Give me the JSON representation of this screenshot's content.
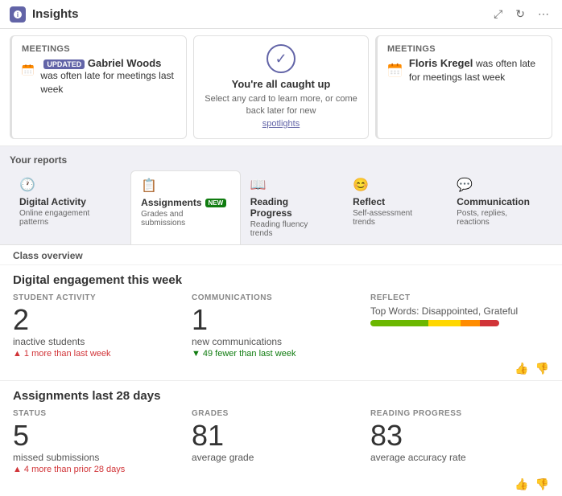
{
  "header": {
    "title": "Insights",
    "actions": [
      "expand",
      "refresh",
      "more"
    ]
  },
  "spotlight": {
    "cards": [
      {
        "id": "card1",
        "type": "meeting",
        "header": "Meetings",
        "badge": "UPDATED",
        "person": "Gabriel Woods",
        "text": "was often late for meetings last week"
      },
      {
        "id": "card-center",
        "type": "caught-up",
        "title": "You're all caught up",
        "sub1": "Select any card to learn more, or come back later for new",
        "link": "spotlights"
      },
      {
        "id": "card3",
        "type": "meeting",
        "header": "Meetings",
        "person": "Floris Kregel",
        "text": "was often late for meetings last week"
      }
    ]
  },
  "reports": {
    "label": "Your reports",
    "tabs": [
      {
        "id": "digital",
        "icon": "🕐",
        "label": "Digital Activity",
        "sub": "Online engagement patterns",
        "active": false
      },
      {
        "id": "assignments",
        "icon": "📋",
        "label": "Assignments",
        "sub": "Grades and submissions",
        "badge": "NEW",
        "active": true
      },
      {
        "id": "reading",
        "icon": "📖",
        "label": "Reading Progress",
        "sub": "Reading fluency trends",
        "active": false
      },
      {
        "id": "reflect",
        "icon": "😊",
        "label": "Reflect",
        "sub": "Self-assessment trends",
        "active": false
      },
      {
        "id": "communication",
        "icon": "💬",
        "label": "Communication",
        "sub": "Posts, replies, reactions",
        "active": false
      }
    ]
  },
  "overview": {
    "label": "Class overview",
    "digital": {
      "title": "Digital engagement",
      "period": "this week",
      "metrics": [
        {
          "label": "STUDENT ACTIVITY",
          "value": "2",
          "desc": "inactive students",
          "change": "1 more than last week",
          "direction": "up"
        },
        {
          "label": "COMMUNICATIONS",
          "value": "1",
          "desc": "new communications",
          "change": "49 fewer than last week",
          "direction": "down"
        },
        {
          "label": "REFLECT",
          "value": null,
          "desc": "Top Words: Disappointed, Grateful",
          "sentiment": [
            45,
            25,
            15,
            15
          ]
        }
      ]
    },
    "assignments": {
      "title": "Assignments",
      "period": "last 28 days",
      "metrics": [
        {
          "label": "STATUS",
          "value": "5",
          "desc": "missed submissions",
          "change": "4 more than prior 28 days",
          "direction": "up"
        },
        {
          "label": "GRADES",
          "value": "81",
          "desc": "average grade",
          "change": null
        },
        {
          "label": "READING PROGRESS",
          "value": "83",
          "desc": "average accuracy rate",
          "change": null
        }
      ]
    }
  }
}
